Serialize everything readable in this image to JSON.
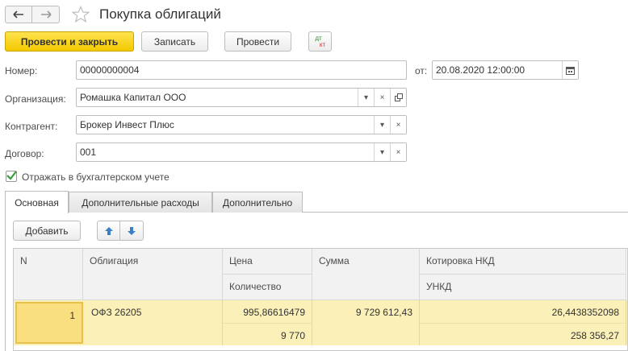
{
  "window": {
    "title": "Покупка облигаций"
  },
  "toolbar": {
    "post_and_close": "Провести и закрыть",
    "save": "Записать",
    "post": "Провести",
    "dt_label": "дт",
    "kt_label": "кт"
  },
  "form": {
    "number_label": "Номер:",
    "number_value": "00000000004",
    "date_label": "от:",
    "date_value": "20.08.2020 12:00:00",
    "organization_label": "Организация:",
    "organization_value": "Ромашка Капитал ООО",
    "counterparty_label": "Контрагент:",
    "counterparty_value": "Брокер Инвест Плюс",
    "contract_label": "Договор:",
    "contract_value": "001",
    "accounting_checkbox_label": "Отражать в бухгалтерском учете",
    "accounting_checked": true
  },
  "tabs": [
    {
      "label": "Основная",
      "active": true
    },
    {
      "label": "Дополнительные расходы",
      "active": false
    },
    {
      "label": "Дополнительно",
      "active": false
    }
  ],
  "table_toolbar": {
    "add": "Добавить"
  },
  "table": {
    "columns": {
      "n": "N",
      "bond": "Облигация",
      "price": "Цена",
      "quantity": "Количество",
      "amount": "Сумма",
      "nkd_quote": "Котировка НКД",
      "unkd": "УНКД"
    },
    "rows": [
      {
        "n": "1",
        "bond": "ОФЗ 26205",
        "price": "995,86616479",
        "quantity": "9 770",
        "amount": "9 729 612,43",
        "nkd_quote": "26,4438352098",
        "unkd": "258 356,27"
      }
    ]
  },
  "colors": {
    "primary_button": "#f3c900",
    "selected_row": "#fbf0b8",
    "selected_cell": "#f9df7f",
    "checkbox_check": "#3a9a3a",
    "arrow_blue": "#3b7fc4"
  }
}
